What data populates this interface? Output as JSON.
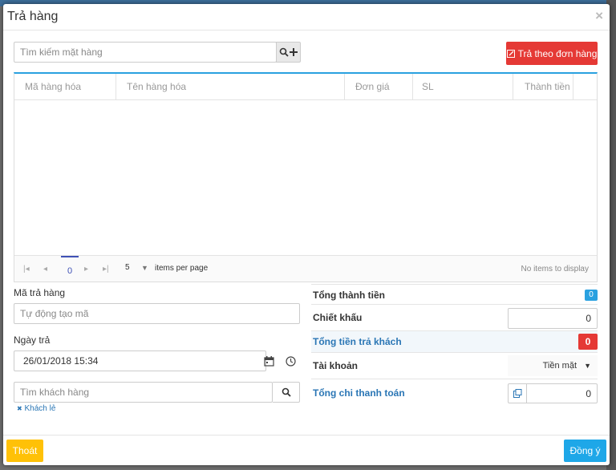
{
  "modal": {
    "title": "Trả hàng",
    "close_glyph": "×"
  },
  "search": {
    "placeholder": "Tìm kiếm mặt hàng",
    "icon": "search-icon",
    "add_icon": "plus-icon"
  },
  "return_by_order": {
    "label": "Trả theo đơn hàng",
    "icon": "edit-icon"
  },
  "grid": {
    "columns": [
      "Mã hàng hóa",
      "Tên hàng hóa",
      "Đơn giá",
      "SL",
      "Thành tiền"
    ],
    "pager": {
      "first": "|◂",
      "prev": "◂",
      "page": "0",
      "next": "▸",
      "last": "▸|",
      "page_size": "5",
      "items_per_page": "items per page",
      "empty": "No items to display"
    }
  },
  "form": {
    "return_code_label": "Mã trả hàng",
    "return_code_placeholder": "Tự động tạo mã",
    "return_date_label": "Ngày trả",
    "return_date_value": "26/01/2018 15:34",
    "customer_placeholder": "Tìm khách hàng",
    "walk_in_customer": "Khách lẻ",
    "walk_in_icon": "✖"
  },
  "summary": {
    "total_label": "Tổng thành tiền",
    "total_value": "0",
    "discount_label": "Chiết khấu",
    "discount_value": "0",
    "refund_label": "Tổng tiền trả khách",
    "refund_value": "0",
    "account_label": "Tài khoản",
    "account_value": "Tiền mặt",
    "paid_label": "Tổng chi thanh toán",
    "paid_value": "0"
  },
  "footer": {
    "exit_label": "Thoát",
    "ok_label": "Đồng ý"
  },
  "colors": {
    "accent": "#2aa1e0",
    "danger": "#e53935",
    "warning": "#ffc107",
    "primary": "#1ea7e8"
  }
}
